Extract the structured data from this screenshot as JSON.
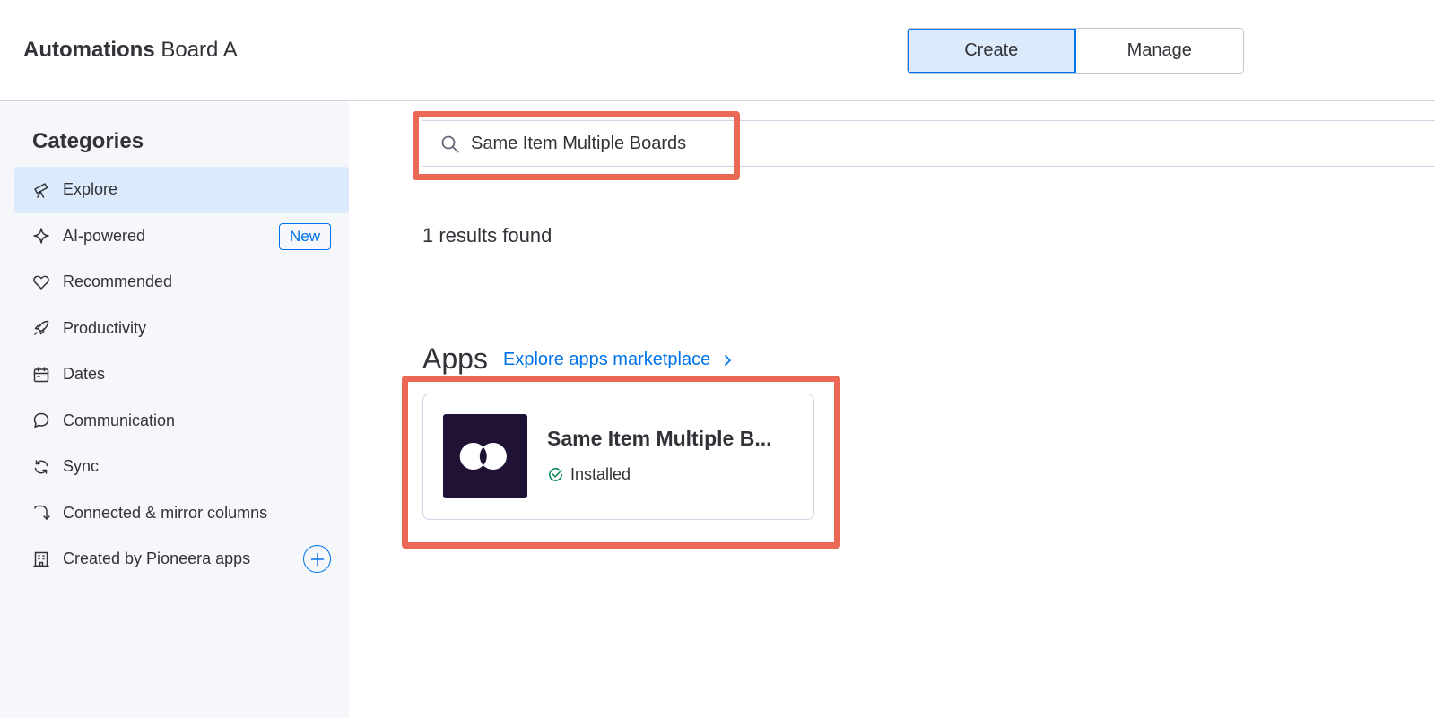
{
  "header": {
    "title_bold": "Automations",
    "title_board": "Board A",
    "tabs": [
      {
        "label": "Create",
        "active": true
      },
      {
        "label": "Manage",
        "active": false
      }
    ]
  },
  "sidebar": {
    "heading": "Categories",
    "items": [
      {
        "label": "Explore",
        "icon": "telescope-icon",
        "active": true
      },
      {
        "label": "AI-powered",
        "icon": "sparkle-icon",
        "badge": "New"
      },
      {
        "label": "Recommended",
        "icon": "heart-icon"
      },
      {
        "label": "Productivity",
        "icon": "rocket-icon"
      },
      {
        "label": "Dates",
        "icon": "calendar-icon"
      },
      {
        "label": "Communication",
        "icon": "chat-bubble-icon"
      },
      {
        "label": "Sync",
        "icon": "sync-icon"
      },
      {
        "label": "Connected & mirror columns",
        "icon": "curved-arrow-icon"
      },
      {
        "label": "Created by Pioneera apps",
        "icon": "building-icon"
      }
    ]
  },
  "search": {
    "value": "Same Item Multiple Boards"
  },
  "results": {
    "text": "1 results found"
  },
  "apps": {
    "heading": "Apps",
    "link_label": "Explore apps marketplace",
    "cards": [
      {
        "name": "Same Item Multiple B...",
        "status": "Installed"
      }
    ]
  },
  "colors": {
    "accent": "#0073ea",
    "highlight": "#eb6856",
    "active_bg": "#dcebfb",
    "logo_bg": "#1f1235",
    "installed": "#00854d"
  }
}
